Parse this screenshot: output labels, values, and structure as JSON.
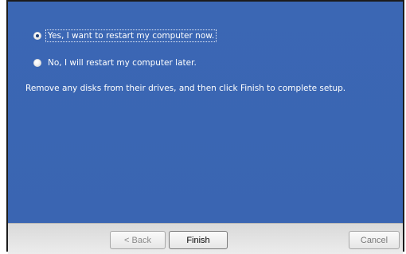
{
  "options": [
    {
      "label": "Yes, I want to restart my computer now.",
      "selected": true
    },
    {
      "label": "No, I will restart my computer later.",
      "selected": false
    }
  ],
  "message": "Remove any disks from their drives, and then click Finish to complete setup.",
  "buttons": {
    "back": "< Back",
    "finish": "Finish",
    "cancel": "Cancel"
  },
  "colors": {
    "panel": "#3a66b3",
    "button_bar": "#e0e0e0"
  }
}
